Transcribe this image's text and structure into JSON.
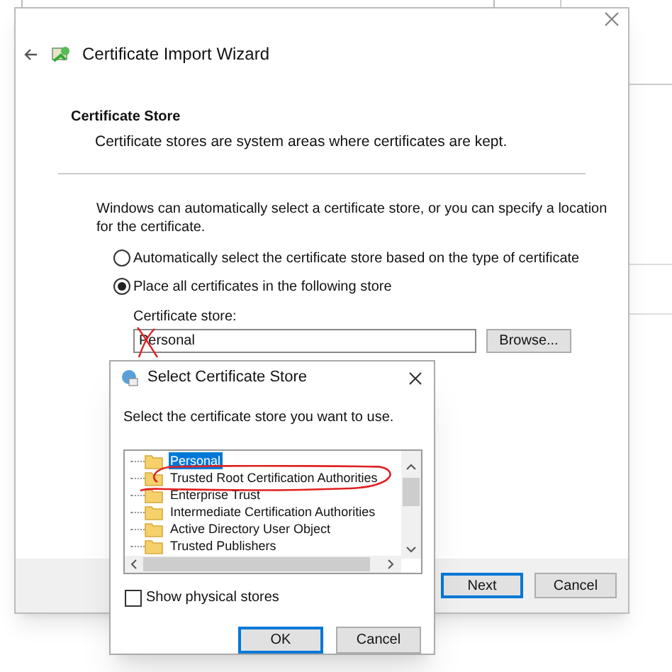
{
  "wizard": {
    "title": "Certificate Import Wizard",
    "heading": "Certificate Store",
    "subheading": "Certificate stores are system areas where certificates are kept.",
    "intro": "Windows can automatically select a certificate store, or you can specify a location for the certificate.",
    "options": [
      {
        "label": "Automatically select the certificate store based on the type of certificate",
        "selected": false
      },
      {
        "label": "Place all certificates in the following store",
        "selected": true
      }
    ],
    "store_label": "Certificate store:",
    "store_value": "Personal",
    "browse_button": "Browse...",
    "buttons": [
      {
        "label": "Next",
        "default": true
      },
      {
        "label": "Cancel",
        "default": false
      }
    ]
  },
  "dialog": {
    "title": "Select Certificate Store",
    "prompt": "Select the certificate store you want to use.",
    "stores": [
      {
        "label": "Personal",
        "selected": true
      },
      {
        "label": "Trusted Root Certification Authorities",
        "selected": false
      },
      {
        "label": "Enterprise Trust",
        "selected": false
      },
      {
        "label": "Intermediate Certification Authorities",
        "selected": false
      },
      {
        "label": "Active Directory User Object",
        "selected": false
      },
      {
        "label": "Trusted Publishers",
        "selected": false
      }
    ],
    "show_physical": {
      "label": "Show physical stores",
      "checked": false
    },
    "buttons": [
      {
        "label": "OK",
        "default": true
      },
      {
        "label": "Cancel",
        "default": false
      }
    ]
  }
}
